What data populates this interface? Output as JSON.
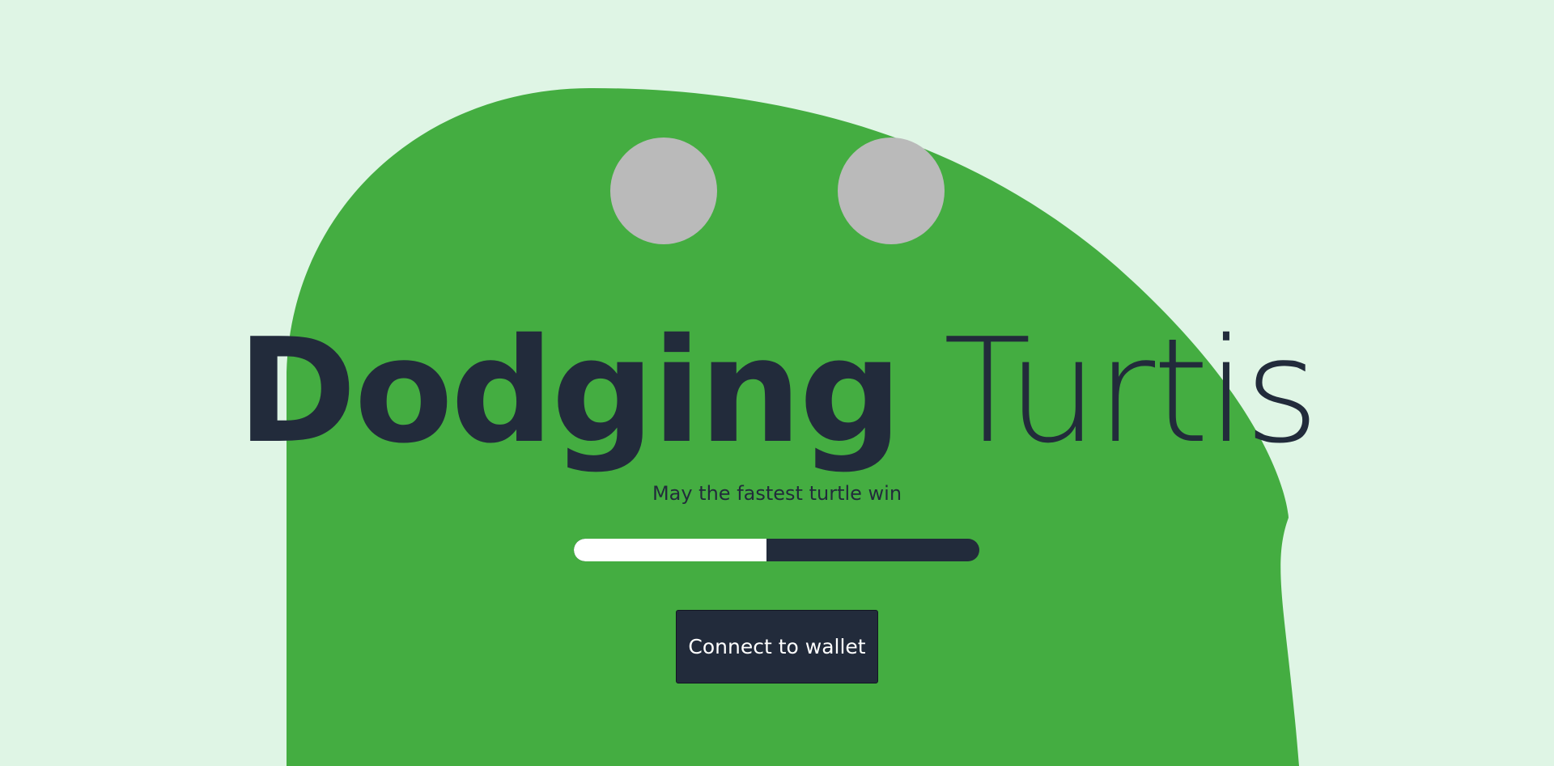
{
  "app": {
    "title": "Dodging Turtis",
    "title_parts": [
      "Dodging",
      "Turtis"
    ],
    "subtitle": "May the fastest turtle win"
  },
  "loader": {
    "progress": 0.475
  },
  "actions": {
    "connect_label": "Connect to wallet"
  },
  "colors": {
    "background": "#dff5e5",
    "shell": "#44ad41",
    "eye": "#bababa",
    "text": "#222b3b",
    "button_bg": "#222b3b",
    "button_text": "#ffffff",
    "progress_fill": "#ffffff",
    "progress_track": "#222b3b"
  }
}
